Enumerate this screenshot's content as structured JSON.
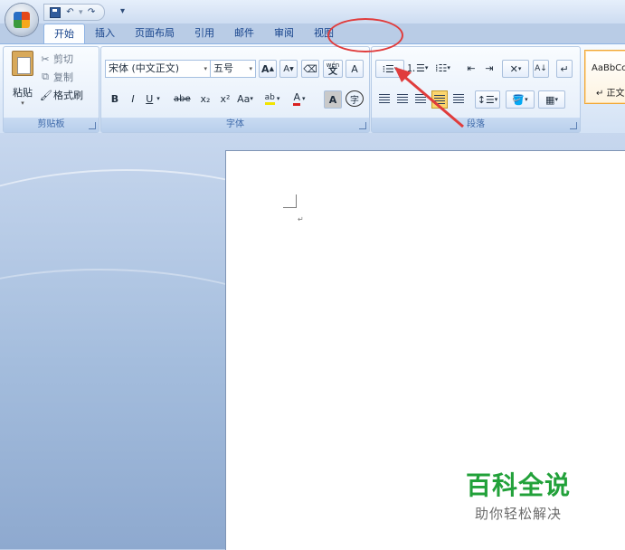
{
  "quick_access": {
    "save_icon": "save-icon",
    "undo_icon": "undo-icon",
    "redo_icon": "redo-icon",
    "customize_icon": "customize-icon"
  },
  "tabs": [
    {
      "label": "开始",
      "active": true
    },
    {
      "label": "插入"
    },
    {
      "label": "页面布局"
    },
    {
      "label": "引用"
    },
    {
      "label": "邮件"
    },
    {
      "label": "审阅"
    },
    {
      "label": "视图"
    }
  ],
  "clipboard": {
    "paste_label": "粘贴",
    "cut_label": "剪切",
    "copy_label": "复制",
    "format_painter_label": "格式刷",
    "group_label": "剪贴板"
  },
  "font": {
    "font_name": "宋体 (中文正文)",
    "font_size": "五号",
    "grow_label": "A",
    "shrink_label": "A",
    "bold": "B",
    "italic": "I",
    "underline": "U",
    "strikethrough": "abe",
    "subscript": "x₂",
    "superscript": "x²",
    "change_case": "Aa",
    "highlight": "ab",
    "font_color": "A",
    "char_shading": "A",
    "enclose": "字",
    "phonetic": "wén",
    "group_label": "字体"
  },
  "paragraph": {
    "group_label": "段落"
  },
  "styles": {
    "sample": "AaBbCc",
    "name": "↵ 正文"
  },
  "watermark": {
    "title": "百科全说",
    "subtitle": "助你轻松解决"
  },
  "colors": {
    "annotation": "#e03c3c",
    "watermark_green": "#22a13a",
    "ribbon_blue": "#15428b"
  }
}
